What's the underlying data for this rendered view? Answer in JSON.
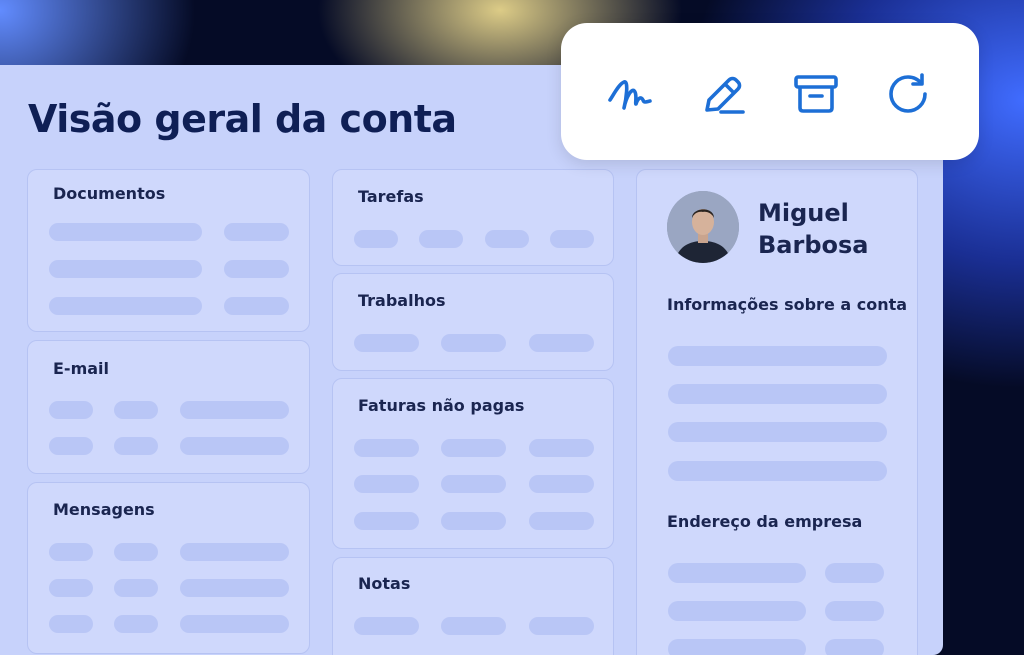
{
  "page_title": "Visão geral da conta",
  "toolbar": {
    "icons": [
      "signature-icon",
      "pen-icon",
      "archive-icon",
      "refresh-icon"
    ],
    "icon_color": "#1d6fd6"
  },
  "cards": {
    "documentos": "Documentos",
    "email": "E-mail",
    "mensagens": "Mensagens",
    "tarefas": "Tarefas",
    "trabalhos": "Trabalhos",
    "faturas": "Faturas não pagas",
    "notas": "Notas"
  },
  "profile": {
    "first_name": "Miguel",
    "last_name": "Barbosa",
    "account_info_label": "Informações sobre a conta",
    "company_address_label": "Endereço da empresa"
  },
  "colors": {
    "panel": "#c7d2fb",
    "card": "#cfd8fc",
    "skeleton": "#b9c6f6",
    "title": "#0f1f55"
  }
}
